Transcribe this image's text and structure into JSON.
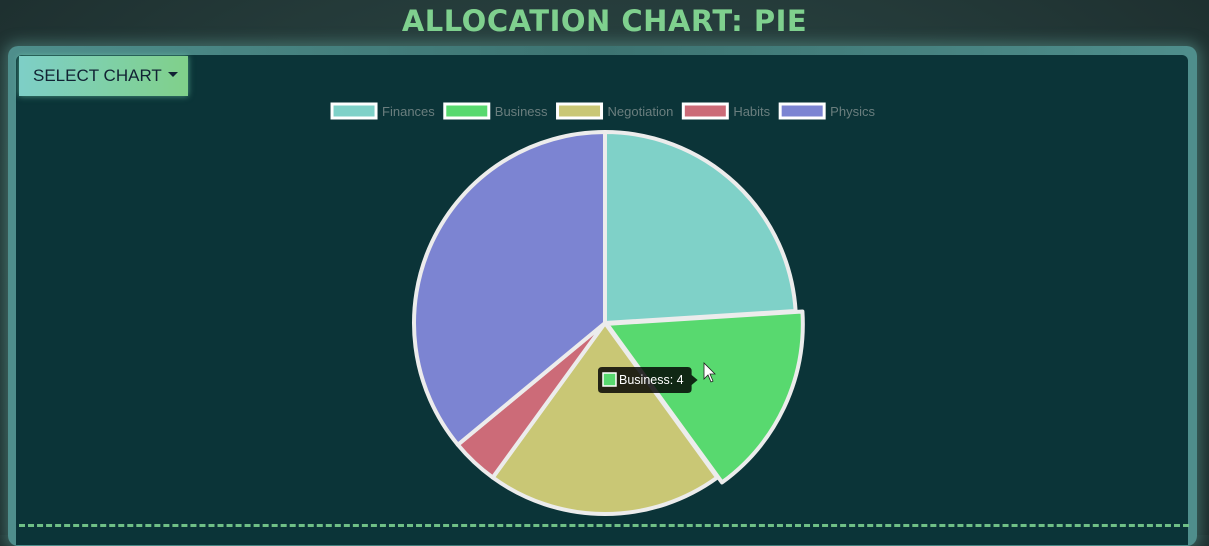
{
  "header": {
    "title": "ALLOCATION CHART: PIE"
  },
  "toolbar": {
    "select_label": "SELECT CHART"
  },
  "colors": {
    "accent": "#7fd08e",
    "panel": "#0b3438"
  },
  "chart_data": {
    "type": "pie",
    "title": "",
    "legend_position": "top",
    "categories": [
      "Finances",
      "Business",
      "Negotiation",
      "Habits",
      "Physics"
    ],
    "values": [
      6,
      4,
      5,
      1,
      9
    ],
    "colors": [
      "#7fd1c8",
      "#58d96f",
      "#c9c775",
      "#cc6b78",
      "#7c84d2"
    ],
    "tooltip": {
      "label": "Business: 4",
      "category": "Business"
    }
  }
}
